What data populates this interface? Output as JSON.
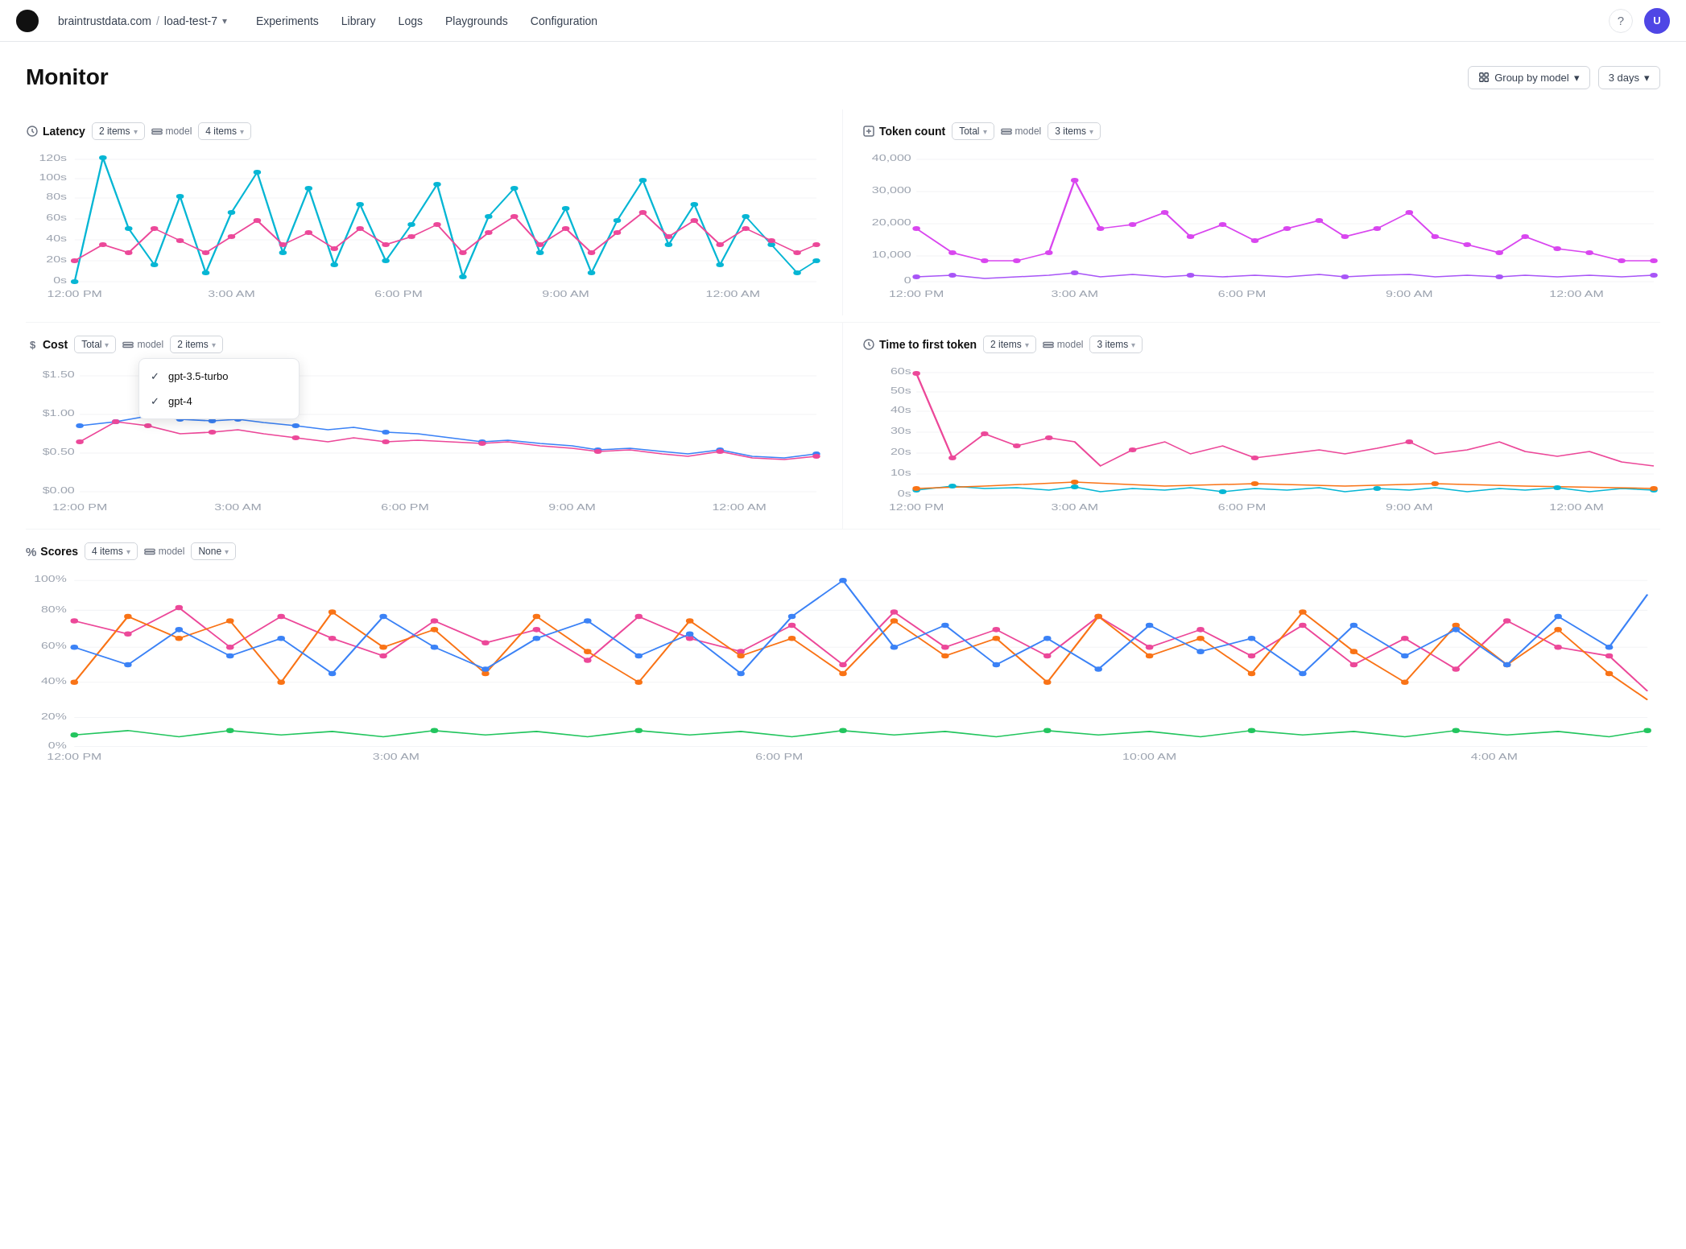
{
  "nav": {
    "breadcrumb_site": "braintrustdata.com",
    "breadcrumb_project": "load-test-7",
    "links": [
      "Experiments",
      "Library",
      "Logs",
      "Playgrounds",
      "Configuration"
    ],
    "avatar_initials": "U"
  },
  "page": {
    "title": "Monitor",
    "group_by_label": "Group by model",
    "days_label": "3 days"
  },
  "latency": {
    "title": "Latency",
    "icon": "latency",
    "filter1": "2 items",
    "filter2_label": "model",
    "filter2": "4 items",
    "x_labels": [
      "12:00 PM",
      "3:00 AM",
      "6:00 PM",
      "9:00 AM",
      "12:00 AM",
      ""
    ],
    "y_labels": [
      "120s",
      "100s",
      "80s",
      "60s",
      "40s",
      "20s",
      "0s"
    ]
  },
  "token_count": {
    "title": "Token count",
    "icon": "token",
    "filter1": "Total",
    "filter2_label": "model",
    "filter2": "3 items",
    "y_labels": [
      "40,000",
      "30,000",
      "20,000",
      "10,000",
      "0"
    ]
  },
  "cost": {
    "title": "Cost",
    "icon": "dollar",
    "filter1": "Total",
    "filter2_label": "model",
    "filter2": "2 items",
    "dropdown_items": [
      "gpt-3.5-turbo",
      "gpt-4"
    ],
    "y_labels": [
      "$1.50",
      "$1.00",
      "$0.50",
      "$0.00"
    ]
  },
  "time_to_first_token": {
    "title": "Time to first token",
    "icon": "clock",
    "filter1": "2 items",
    "filter2_label": "model",
    "filter2": "3 items",
    "y_labels": [
      "60s",
      "50s",
      "40s",
      "30s",
      "20s",
      "10s",
      "0s"
    ]
  },
  "scores": {
    "title": "Scores",
    "icon": "percent",
    "filter1": "4 items",
    "filter2_label": "model",
    "filter2": "None",
    "y_labels": [
      "100%",
      "80%",
      "60%",
      "40%",
      "20%",
      "0%"
    ]
  },
  "colors": {
    "cyan": "#06b6d4",
    "pink": "#ec4899",
    "blue": "#3b82f6",
    "orange": "#f97316",
    "green": "#22c55e",
    "purple": "#a855f7",
    "magenta": "#d946ef"
  }
}
